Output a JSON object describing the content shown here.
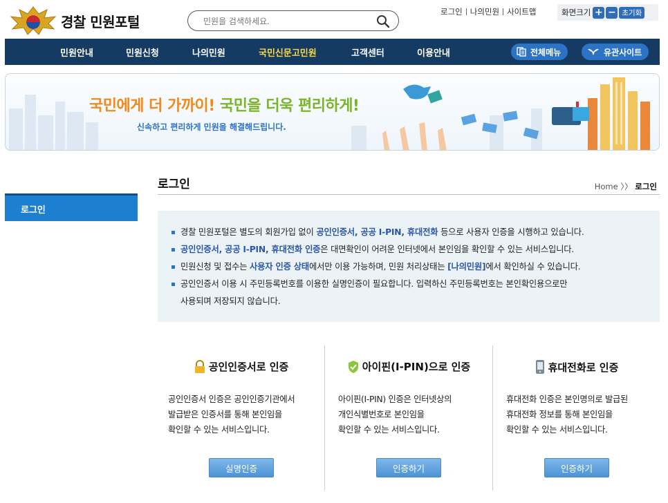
{
  "header": {
    "site_title": "경찰 민원포털",
    "search_placeholder": "민원을 검색하세요.",
    "util_links": [
      "로그인",
      "나의민원",
      "사이트맵"
    ],
    "font_size_label": "화면크기",
    "font_plus": "+",
    "font_minus": "−",
    "font_reset": "초기화"
  },
  "nav": {
    "items": [
      "민원안내",
      "민원신청",
      "나의민원",
      "국민신문고민원",
      "고객센터",
      "이용안내"
    ],
    "active_index": 3,
    "all_menu": "전체메뉴",
    "related_sites": "유관사이트"
  },
  "banner": {
    "title_part1": "국민에게 더 가까이!",
    "title_part2": "국민을 더욱 편리하게!",
    "subtitle": "신속하고 편리하게 민원을 해결해드립니다."
  },
  "sidebar": {
    "items": [
      "로그인"
    ]
  },
  "page": {
    "title": "로그인",
    "breadcrumb_home": "Home",
    "breadcrumb_sep": "〉〉",
    "breadcrumb_current": "로그인"
  },
  "info": {
    "line1_a": "경찰 민원포털은 별도의 회원가입 없이 ",
    "line1_hl": "공인인증서, 공공 I-PIN, 휴대전화",
    "line1_b": " 등으로 사용자 인증을 시행하고 있습니다.",
    "line2_hl": "공인인증서, 공공 I-PIN, 휴대전화 인증",
    "line2_b": "은 대면확인이 어려운 인터넷에서 본인임을 확인할 수 있는 서비스입니다.",
    "line3_a": "민원신청 및 접수는 ",
    "line3_hl1": "사용자 인증 상태",
    "line3_b": "에서만 이용 가능하며, 민원 처리상태는 ",
    "line3_hl2": "[나의민원]",
    "line3_c": "에서 확인하실 수 있습니다.",
    "line4_a": "공인인증서 이용 시 주민등록번호를 이용한 실명인증이 필요합니다. 입력하신 주민등록번호는 본인확인용으로만",
    "line4_b": "사용되며 저장되지 않습니다."
  },
  "cards": [
    {
      "title": "공인인증서로 인증",
      "desc": [
        "공인인증서 인증은 공인인증기관에서",
        "발급받은 인증서를 통해 본인임을",
        "확인할 수 있는 서비스입니다."
      ],
      "button": "실명인증"
    },
    {
      "title": "아이핀(I-PIN)으로 인증",
      "desc": [
        "아이핀(I-PIN) 인증은 인터넷상의",
        "개인식별번호로 본인임을",
        "확인할 수 있는 서비스입니다."
      ],
      "button": "인증하기"
    },
    {
      "title": "휴대전화로 인증",
      "desc": [
        "휴대전화 인증은 본인명의로 발급된",
        "휴대전화 정보를 통해 본인임을",
        "확인할 수 있는 서비스입니다."
      ],
      "button": "인증하기"
    }
  ],
  "colors": {
    "nav_bg": "#153b63",
    "nav_active": "#f5d94a",
    "accent_blue": "#2c73c6",
    "sidebar_active": "#1c7fd0",
    "banner_orange": "#f08a1a",
    "banner_green": "#7ab529",
    "info_bg": "#ecf3f6"
  }
}
